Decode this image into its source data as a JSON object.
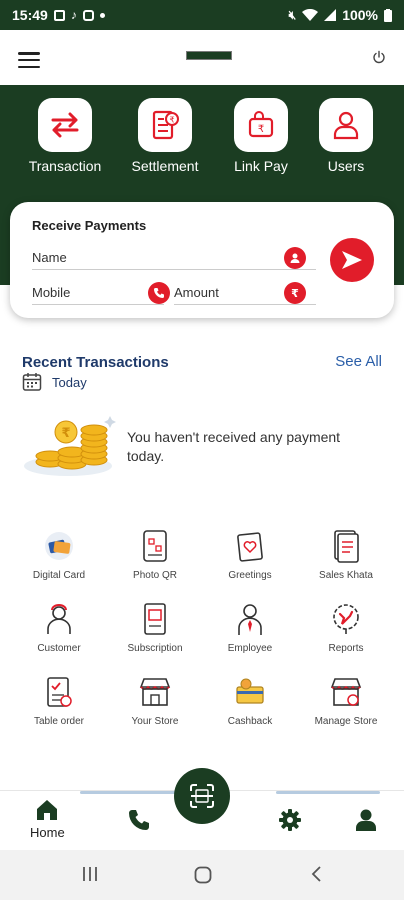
{
  "status_bar": {
    "time": "15:49",
    "battery": "100%"
  },
  "colors": {
    "brand_green": "#1b3d22",
    "accent_red": "#e11d2a",
    "link_blue": "#2a5ea8",
    "title_navy": "#1f3a6a"
  },
  "quick_actions": [
    {
      "label": "Transaction",
      "icon": "transfer-arrows-icon"
    },
    {
      "label": "Settlement",
      "icon": "settlement-document-icon"
    },
    {
      "label": "Link Pay",
      "icon": "link-pay-wallet-icon"
    },
    {
      "label": "Users",
      "icon": "user-icon"
    }
  ],
  "receive_payments": {
    "title": "Receive Payments",
    "name_placeholder": "Name",
    "mobile_placeholder": "Mobile",
    "amount_placeholder": "Amount"
  },
  "recent_transactions": {
    "title": "Recent Transactions",
    "see_all": "See All",
    "period": "Today",
    "empty_message": "You haven't received any payment today."
  },
  "services": [
    {
      "label": "Digital Card",
      "icon": "digital-card-icon"
    },
    {
      "label": "Photo QR",
      "icon": "photo-qr-icon"
    },
    {
      "label": "Greetings",
      "icon": "greetings-icon"
    },
    {
      "label": "Sales Khata",
      "icon": "sales-khata-icon"
    },
    {
      "label": "Customer",
      "icon": "customer-icon"
    },
    {
      "label": "Subscription",
      "icon": "subscription-icon"
    },
    {
      "label": "Employee",
      "icon": "employee-icon"
    },
    {
      "label": "Reports",
      "icon": "reports-icon"
    },
    {
      "label": "Table order",
      "icon": "table-order-icon"
    },
    {
      "label": "Your Store",
      "icon": "store-icon"
    },
    {
      "label": "Cashback",
      "icon": "cashback-icon"
    },
    {
      "label": "Manage Store",
      "icon": "manage-store-icon"
    }
  ],
  "bottom_nav": {
    "home_label": "Home"
  }
}
